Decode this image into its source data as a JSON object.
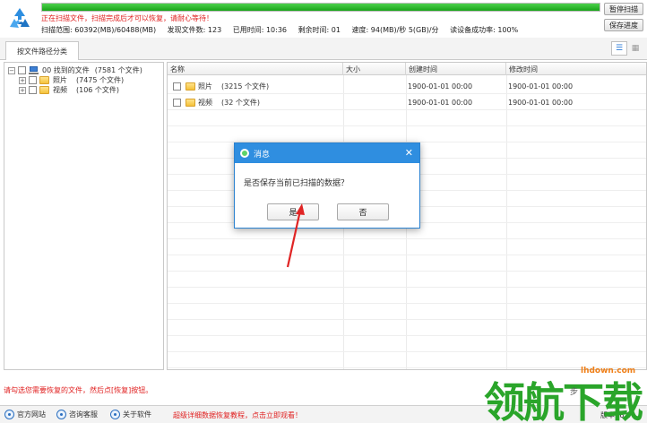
{
  "header": {
    "progress_percent": 100,
    "status_text": "正在扫描文件，扫描完成后才可以恢复，请耐心等待！",
    "stats": [
      "扫描范围: 60392(MB)/60488(MB)",
      "发现文件数: 123",
      "已用时间: 10:36",
      "剩余时间: 01",
      "速度: 94(MB)/秒  5(GB)/分",
      "读设备成功率: 100%"
    ],
    "pause_label": "暂停扫描",
    "save_label": "保存进度"
  },
  "tabs": {
    "active": "按文件路径分类",
    "view_list_icon": "list-view-icon",
    "view_grid_icon": "grid-view-icon"
  },
  "tree": {
    "root": {
      "label": "00 找到的文件",
      "count": "(7581 个文件)"
    },
    "children": [
      {
        "label": "照片",
        "count": "(7475 个文件)"
      },
      {
        "label": "视频",
        "count": "(106 个文件)"
      }
    ]
  },
  "list": {
    "columns": [
      "名称",
      "大小",
      "创建时间",
      "修改时间"
    ],
    "rows": [
      {
        "name": "照片",
        "count": "(3215 个文件)",
        "created": "1900-01-01 00:00",
        "modified": "1900-01-01 00:00"
      },
      {
        "name": "视频",
        "count": "(32 个文件)",
        "created": "1900-01-01 00:00",
        "modified": "1900-01-01 00:00"
      }
    ]
  },
  "dialog": {
    "title": "消息",
    "message": "是否保存当前已扫描的数据？",
    "yes_label": "是",
    "no_label": "否",
    "close_glyph": "✕"
  },
  "footer": {
    "hint": "请勾选您需要恢复的文件，然后点[恢复]按钮。",
    "links": [
      "官方网站",
      "咨询客服",
      "关于软件"
    ],
    "promo": "超级详细数据恢复教程，点击立即观看！",
    "version": "版本: 6.8"
  },
  "watermark": {
    "text": "领航下载",
    "url": "lhdown.com",
    "step": "步"
  },
  "colors": {
    "accent": "#2f8ee0",
    "progress": "#18a418",
    "alert": "#e02020",
    "watermark": "#2aa52a"
  }
}
